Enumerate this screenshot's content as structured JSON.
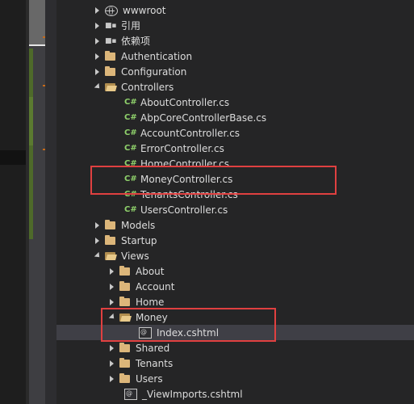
{
  "tree": {
    "items": [
      {
        "label": "wwwroot",
        "icon": "globe-icon",
        "expander": "collapsed"
      },
      {
        "label": "引用",
        "icon": "references-icon",
        "expander": "collapsed"
      },
      {
        "label": "依赖项",
        "icon": "dependencies-icon",
        "expander": "collapsed"
      },
      {
        "label": "Authentication",
        "icon": "folder-icon",
        "expander": "collapsed"
      },
      {
        "label": "Configuration",
        "icon": "folder-icon",
        "expander": "collapsed"
      },
      {
        "label": "Controllers",
        "icon": "folder-open-icon",
        "expander": "expanded"
      },
      {
        "label": "AboutController.cs",
        "icon": "csharp-file-icon"
      },
      {
        "label": "AbpCoreControllerBase.cs",
        "icon": "csharp-file-icon"
      },
      {
        "label": "AccountController.cs",
        "icon": "csharp-file-icon"
      },
      {
        "label": "ErrorController.cs",
        "icon": "csharp-file-icon"
      },
      {
        "label": "HomeController.cs",
        "icon": "csharp-file-icon"
      },
      {
        "label": "MoneyController.cs",
        "icon": "csharp-file-icon"
      },
      {
        "label": "TenantsController.cs",
        "icon": "csharp-file-icon"
      },
      {
        "label": "UsersController.cs",
        "icon": "csharp-file-icon"
      },
      {
        "label": "Models",
        "icon": "folder-icon",
        "expander": "collapsed"
      },
      {
        "label": "Startup",
        "icon": "folder-icon",
        "expander": "collapsed"
      },
      {
        "label": "Views",
        "icon": "folder-open-icon",
        "expander": "expanded"
      },
      {
        "label": "About",
        "icon": "folder-icon",
        "expander": "collapsed"
      },
      {
        "label": "Account",
        "icon": "folder-icon",
        "expander": "collapsed"
      },
      {
        "label": "Home",
        "icon": "folder-icon",
        "expander": "none"
      },
      {
        "label": "Money",
        "icon": "folder-open-icon",
        "expander": "expanded"
      },
      {
        "label": "Index.cshtml",
        "icon": "razor-file-icon",
        "selected": true
      },
      {
        "label": "Shared",
        "icon": "folder-icon",
        "expander": "collapsed"
      },
      {
        "label": "Tenants",
        "icon": "folder-icon",
        "expander": "collapsed"
      },
      {
        "label": "Users",
        "icon": "folder-icon",
        "expander": "collapsed"
      },
      {
        "label": "_ViewImports.cshtml",
        "icon": "razor-file-icon"
      }
    ]
  },
  "colors": {
    "background": "#252526",
    "selection": "#3f3f46",
    "highlight_box": "#e04040",
    "folder": "#dcb67a",
    "csharp": "#8fd16b"
  }
}
